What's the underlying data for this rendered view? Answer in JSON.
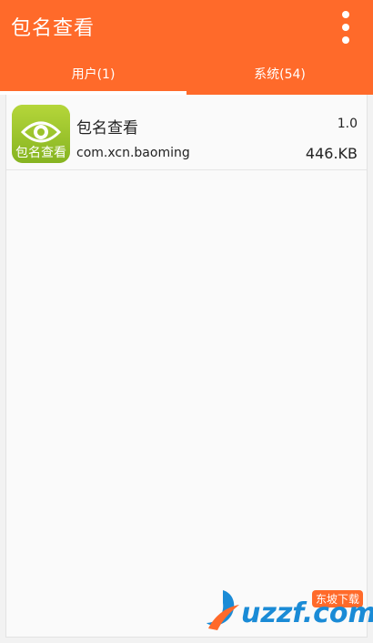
{
  "header": {
    "title": "包名查看",
    "menu_icon": "more-vert-icon"
  },
  "tabs": [
    {
      "label": "用户(1)",
      "active": true
    },
    {
      "label": "系统(54)",
      "active": false
    }
  ],
  "apps": [
    {
      "icon": "eye-icon",
      "icon_label": "包名查看",
      "name": "包名查看",
      "version": "1.0",
      "package": "com.xcn.baoming",
      "size": "446.KB"
    }
  ],
  "watermark": {
    "brand": "uzzf.com",
    "cn": "东坡下载"
  },
  "colors": {
    "accent": "#ff6a2a",
    "icon_bg": "#9cc22b",
    "watermark": "#1a8bd6"
  }
}
